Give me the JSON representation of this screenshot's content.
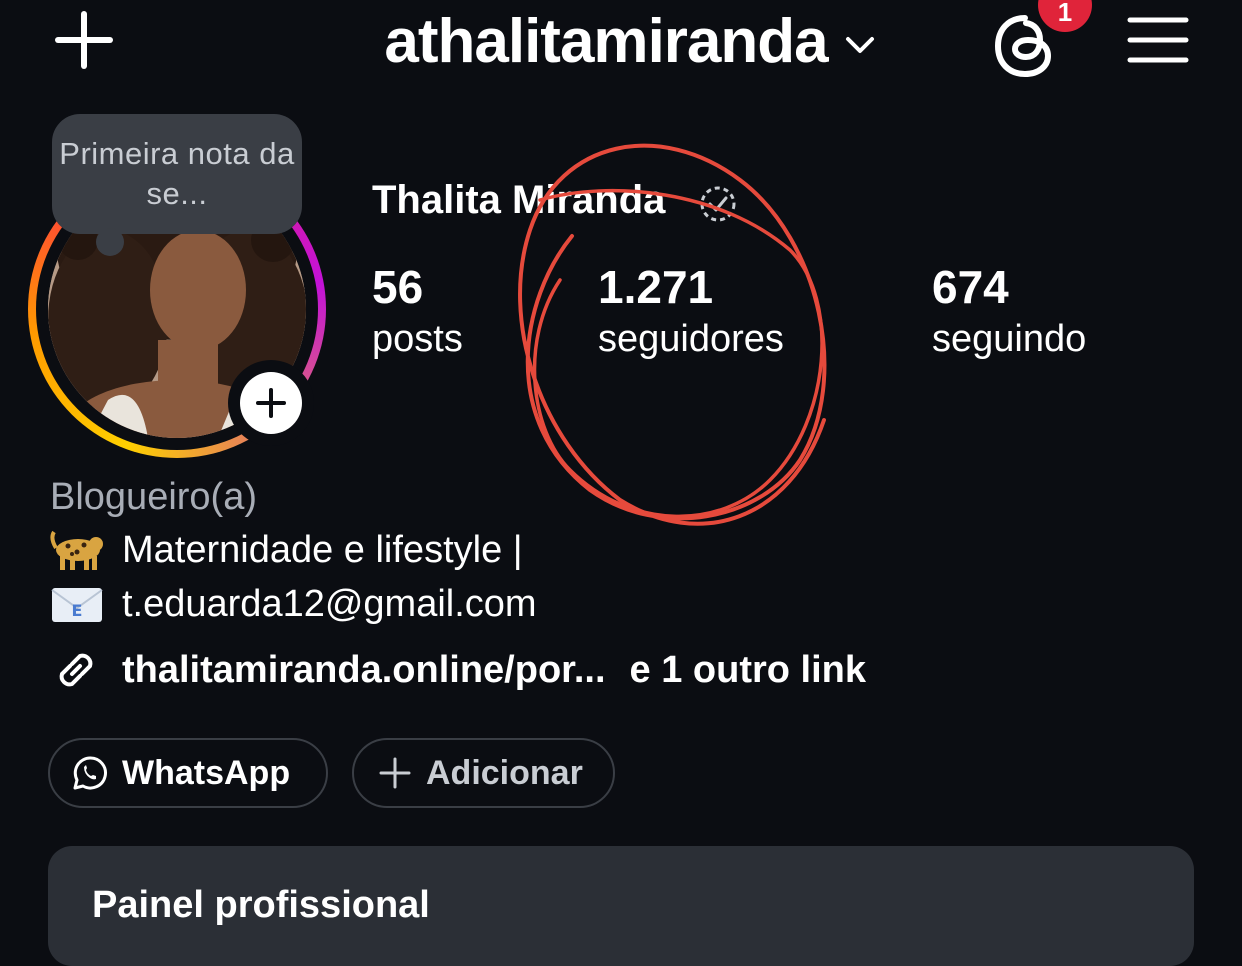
{
  "header": {
    "username": "athalitamiranda",
    "notification_count": "1",
    "icons": [
      "plus-icon",
      "chevron-down-icon",
      "threads-icon",
      "menu-icon"
    ]
  },
  "profile": {
    "note": "Primeira nota da se...",
    "display_name": "Thalita Miranda",
    "stats": [
      {
        "value": "56",
        "label": "posts"
      },
      {
        "value": "1.271",
        "label": "seguidores"
      },
      {
        "value": "674",
        "label": "seguindo"
      }
    ],
    "category": "Blogueiro(a)",
    "bio": [
      {
        "icon": "leopard-emoji",
        "text": "Maternidade e lifestyle |"
      },
      {
        "icon": "email-emoji",
        "text": "t.eduarda12@gmail.com"
      }
    ],
    "link": {
      "text": "thalitamiranda.online/por...",
      "more": "e 1 outro link"
    }
  },
  "chips": {
    "whatsapp": "WhatsApp",
    "add": "Adicionar"
  },
  "dashboard": {
    "title": "Painel profissional"
  },
  "colors": {
    "background": "#0b0d12",
    "badge": "#e0243a",
    "card": "#2b2f36",
    "annotation": "#e64a3c"
  }
}
